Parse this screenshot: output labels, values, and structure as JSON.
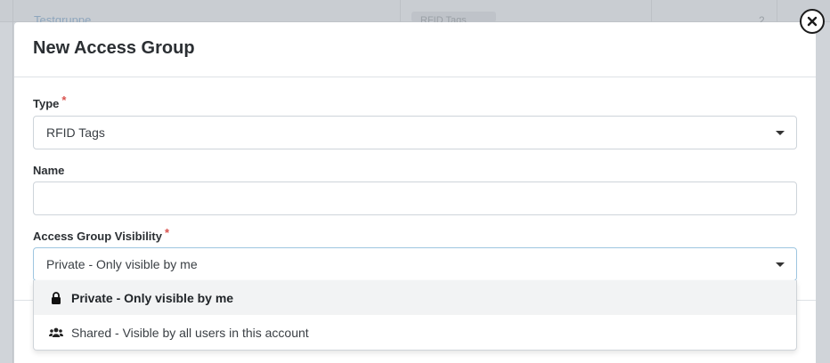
{
  "background": {
    "row_name": "Testgruppe",
    "row_badge": "RFID Tags",
    "row_count": "2"
  },
  "modal": {
    "title": "New Access Group",
    "fields": {
      "type": {
        "label": "Type",
        "required_mark": "*",
        "value": "RFID Tags"
      },
      "name": {
        "label": "Name",
        "value": ""
      },
      "visibility": {
        "label": "Access Group Visibility",
        "required_mark": "*",
        "value": "Private - Only visible by me"
      }
    },
    "dropdown": {
      "options": [
        {
          "label": "Private - Only visible by me",
          "icon": "lock-icon",
          "selected": true
        },
        {
          "label": "Shared - Visible by all users in this account",
          "icon": "users-icon",
          "selected": false
        }
      ]
    }
  },
  "colors": {
    "required": "#d9534f",
    "primary_button": "#0e4f73",
    "focus_border": "#9ec6e0"
  }
}
